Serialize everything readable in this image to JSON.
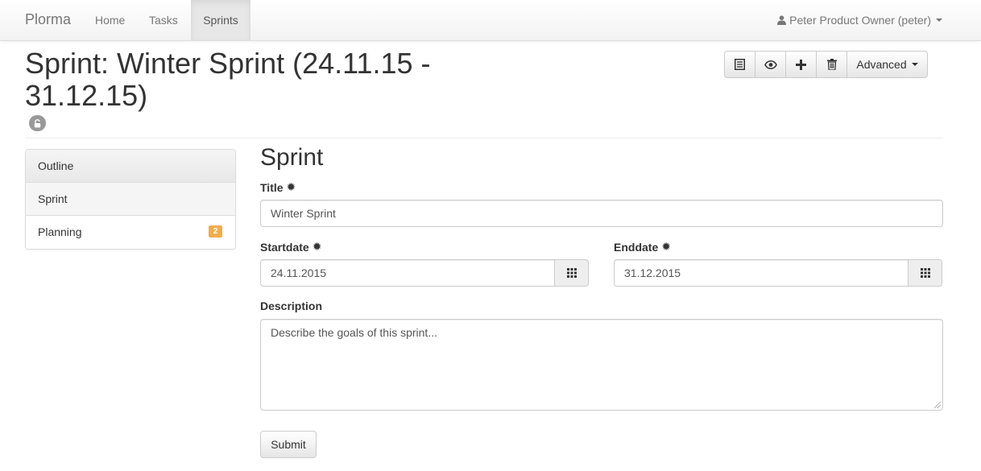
{
  "navbar": {
    "brand": "Plorma",
    "links": [
      "Home",
      "Tasks",
      "Sprints"
    ],
    "active": "Sprints",
    "user": "Peter Product Owner (peter)",
    "user_icon": "user-icon"
  },
  "header": {
    "title": "Sprint: Winter Sprint (24.11.15 - 31.12.15)",
    "status_icon": "unlock-icon"
  },
  "toolbar": {
    "icons": [
      "list-icon",
      "eye-icon",
      "plus-icon",
      "trash-icon"
    ],
    "advanced_label": "Advanced"
  },
  "sidebar": {
    "items": [
      {
        "label": "Outline"
      },
      {
        "label": "Sprint"
      },
      {
        "label": "Planning",
        "badge": "2"
      }
    ]
  },
  "form": {
    "heading": "Sprint",
    "title_label": "Title",
    "title_value": "Winter Sprint",
    "startdate_label": "Startdate",
    "startdate_value": "24.11.2015",
    "enddate_label": "Enddate",
    "enddate_value": "31.12.2015",
    "description_label": "Description",
    "description_placeholder": "Describe the goals of this sprint...",
    "required_marker": "✹",
    "submit_label": "Submit"
  },
  "colors": {
    "badge": "#f0ad4e",
    "navbar_active": "#e7e7e7",
    "text": "#333333"
  }
}
